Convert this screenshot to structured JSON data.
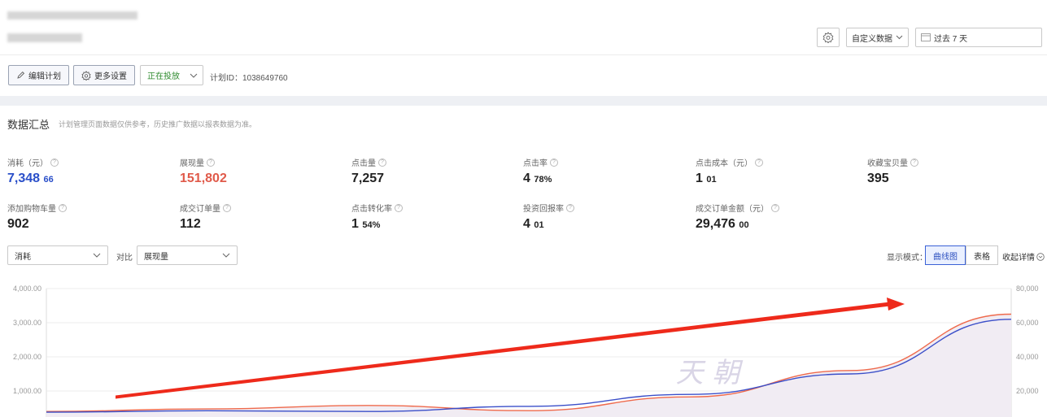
{
  "header": {
    "custom_data_label": "自定义数据",
    "date_range_label": "过去 7 天"
  },
  "actions": {
    "edit_plan": "编辑计划",
    "more_settings": "更多设置",
    "status": "正在投放",
    "plan_id": "计划ID：1038649760"
  },
  "summary": {
    "title": "数据汇总",
    "note": "计划管理页面数据仅供参考，历史推广数据以报表数据为准。"
  },
  "metrics_row1": [
    {
      "label": "消耗（元）",
      "int": "7,348",
      "dec": "66",
      "color": "#2a4fc9"
    },
    {
      "label": "展现量",
      "int": "151,802",
      "dec": "",
      "color": "#e05a4a"
    },
    {
      "label": "点击量",
      "int": "7,257",
      "dec": "",
      "color": "#222222"
    },
    {
      "label": "点击率",
      "int": "4",
      "dec": "78%",
      "color": "#222222"
    },
    {
      "label": "点击成本（元）",
      "int": "1",
      "dec": "01",
      "color": "#222222"
    },
    {
      "label": "收藏宝贝量",
      "int": "395",
      "dec": "",
      "color": "#222222"
    }
  ],
  "metrics_row2": [
    {
      "label": "添加购物车量",
      "int": "902",
      "dec": "",
      "color": "#222222"
    },
    {
      "label": "成交订单量",
      "int": "112",
      "dec": "",
      "color": "#222222"
    },
    {
      "label": "点击转化率",
      "int": "1",
      "dec": "54%",
      "color": "#222222"
    },
    {
      "label": "投资回报率",
      "int": "4",
      "dec": "01",
      "color": "#222222"
    },
    {
      "label": "成交订单金额（元）",
      "int": "29,476",
      "dec": "00",
      "color": "#222222"
    }
  ],
  "controls": {
    "primary_metric": "消耗",
    "versus_label": "对比",
    "compare_metric": "展现量",
    "display_mode_label": "显示模式：",
    "mode_curve": "曲线图",
    "mode_table": "表格",
    "collapse_label": "收起详情"
  },
  "chart_data": {
    "type": "line",
    "left_axis_ticks": [
      "4,000.00",
      "3,000.00",
      "2,000.00",
      "1,000.00"
    ],
    "right_axis_ticks": [
      "80,000",
      "60,000",
      "40,000",
      "20,000"
    ],
    "ylim_left": [
      0,
      4000
    ],
    "ylim_right": [
      0,
      80000
    ],
    "x": [
      0,
      1,
      2,
      3,
      4,
      5,
      6
    ],
    "series": [
      {
        "name": "消耗",
        "axis": "left",
        "color": "#3b4fc9",
        "values": [
          380,
          420,
          400,
          550,
          900,
          1500,
          3100
        ]
      },
      {
        "name": "展现量",
        "axis": "right",
        "color": "#ef6a4c",
        "values": [
          8000,
          9500,
          11500,
          8500,
          16500,
          32000,
          65000
        ]
      }
    ],
    "watermark": "天 朝",
    "annotation_color": "#ee2a1b"
  }
}
